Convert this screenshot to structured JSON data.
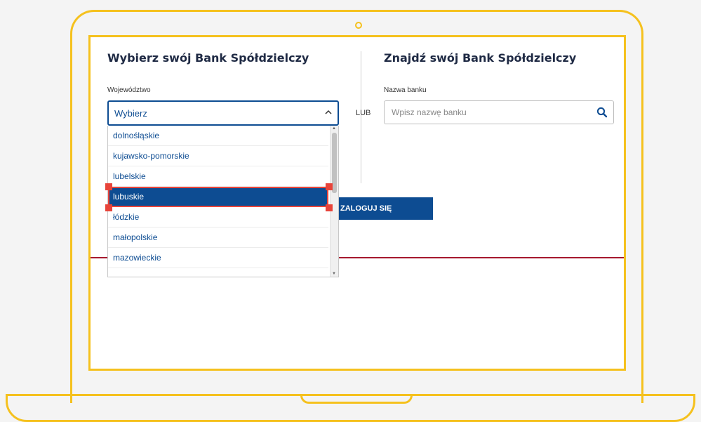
{
  "left_panel": {
    "title": "Wybierz swój Bank Spółdzielczy",
    "region_label": "Województwo",
    "region_select": {
      "value": "Wybierz"
    }
  },
  "separator": "LUB",
  "right_panel": {
    "title": "Znajdź swój Bank Spółdzielczy",
    "bank_name_label": "Nazwa banku",
    "bank_name_placeholder": "Wpisz nazwę banku"
  },
  "login_button": "ZALOGUJ SIĘ",
  "dropdown": {
    "options": [
      "dolnośląskie",
      "kujawsko-pomorskie",
      "lubelskie",
      "lubuskie",
      "łódzkie",
      "małopolskie",
      "mazowieckie"
    ],
    "highlighted": "lubuskie"
  },
  "colors": {
    "brand_blue": "#0d4c92",
    "frame_yellow": "#f5c11e",
    "accent_red": "#a6192e",
    "highlight_outline": "#e8443a"
  }
}
